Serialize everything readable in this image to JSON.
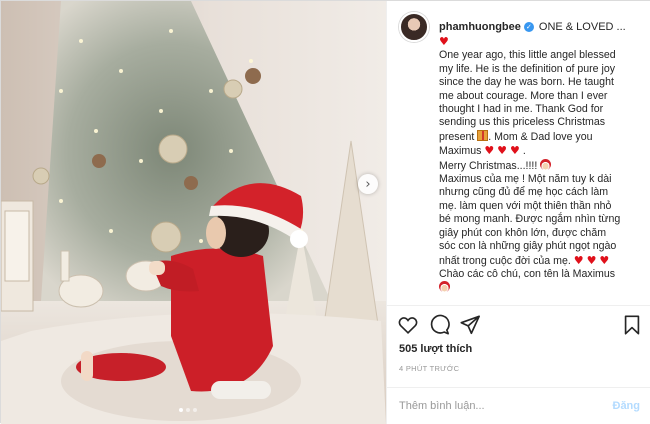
{
  "post": {
    "username": "phamhuongbee",
    "caption_head": "ONE & LOVED ...",
    "caption_lines": [
      "One year ago, this little angel blessed",
      "my life. He is the definition of pure joy",
      "since the day he was born. He taught",
      "me about courage. More than I ever",
      "thought I had in me. Thank God for",
      "sending us this priceless Christmas",
      "present",
      ". Mom & Dad love you",
      "Maximus",
      "Merry Christmas...!!!!",
      "Maximus của mẹ ! Một năm tuy k dài",
      "nhưng cũng đủ để mẹ học cách làm",
      "mẹ. làm quen với một thiên thần nhỏ",
      "bé mong manh. Được ngắm nhìn từng",
      "giây phút con khôn lớn, được chăm",
      "sóc con là những giây phút ngọt ngào",
      "nhất trong cuộc đời của mẹ.",
      "Chào các cô chú, con tên là Maximus"
    ],
    "heart_glyph": "♥",
    "likes": "505 lượt thích",
    "timestamp": "4 PHÚT TRƯỚC",
    "comment_placeholder": "Thêm bình luận...",
    "post_button": "Đăng",
    "next_arrow": "›",
    "verified_glyph": "✓",
    "carousel_total": 3,
    "carousel_active": 1
  },
  "colors": {
    "heart": "#e0101a",
    "verified": "#3897f0",
    "post_button_disabled": "#b3dbff",
    "muted_text": "#999999"
  },
  "icons": [
    "heart-outline-icon",
    "comment-icon",
    "share-icon",
    "bookmark-icon",
    "verified-icon",
    "gift-emoji-icon",
    "santa-emoji-icon",
    "chevron-right-icon"
  ]
}
